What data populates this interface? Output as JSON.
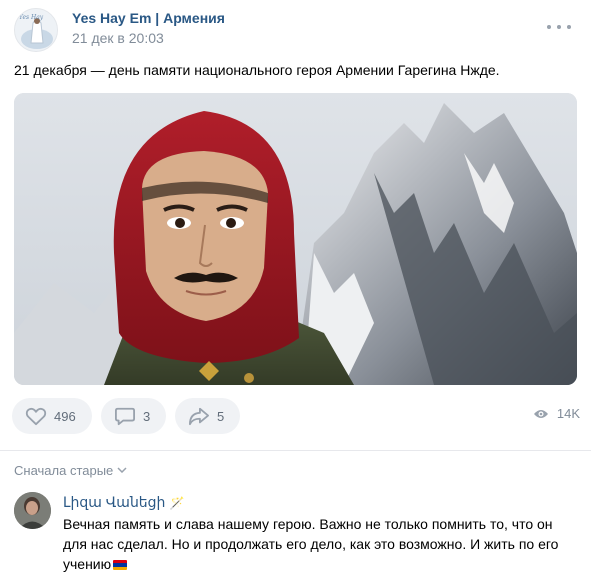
{
  "post": {
    "author": "Yes Hay Em | Армения",
    "date": "21 дек в 20:03",
    "text": "21 декабря — день памяти национального героя Армении Гарегина Нжде.",
    "image_alt": "Портрет Гарегина Нжде на фоне гор"
  },
  "actions": {
    "likes": "496",
    "comments": "3",
    "shares": "5",
    "views": "14K"
  },
  "comments_section": {
    "sort_label": "Сначала старые"
  },
  "comment": {
    "author": "Լիզա Վանեցի",
    "badge": "🪄",
    "text": "Вечная память и слава нашему герою. Важно не только помнить то, что он для нас сделал. Но и продолжать его дело, как это возможно. И жить по его учению"
  },
  "colors": {
    "link": "#2a5885",
    "meta": "#818c99",
    "button_bg": "#f0f2f5",
    "flag_red": "#d90012",
    "flag_blue": "#0033a0",
    "flag_orange": "#f2a800"
  }
}
